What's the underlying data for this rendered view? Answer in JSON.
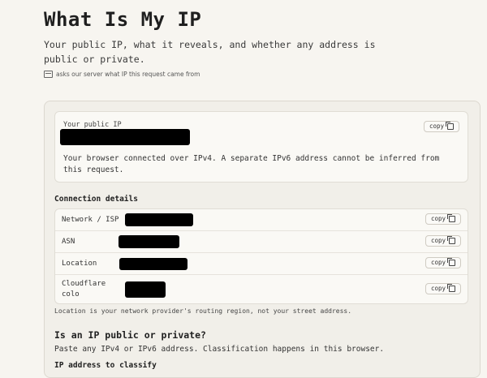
{
  "header": {
    "title": "What Is My IP",
    "subtitle": "Your public IP, what it reveals, and whether any address is public or private.",
    "hint": "asks our server what IP this request came from"
  },
  "ip_card": {
    "label": "Your public IP",
    "copy_label": "copy",
    "message": "Your browser connected over IPv4. A separate IPv6 address cannot be inferred from this request."
  },
  "connection": {
    "heading": "Connection details",
    "copy_label": "copy",
    "rows": [
      {
        "key": "Network / ISP"
      },
      {
        "key": "ASN"
      },
      {
        "key": "Location"
      },
      {
        "key": "Cloudflare colo"
      }
    ],
    "note": "Location is your network provider's routing region, not your street address."
  },
  "classify": {
    "heading": "Is an IP public or private?",
    "description": "Paste any IPv4 or IPv6 address. Classification happens in this browser.",
    "field_label": "IP address to classify"
  }
}
